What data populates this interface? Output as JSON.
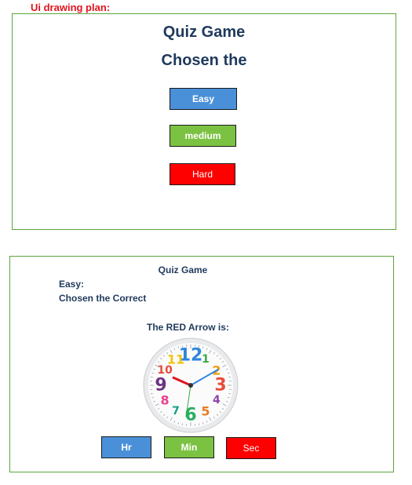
{
  "heading": "Ui drawing plan:",
  "screen1": {
    "title": "Quiz Game",
    "subtitle": "Chosen the",
    "buttons": {
      "easy": "Easy",
      "medium": "medium",
      "hard": "Hard"
    }
  },
  "screen2": {
    "title": "Quiz Game",
    "level": "Easy:",
    "instruction": "Chosen the Correct",
    "question": "The RED Arrow is:",
    "clock": {
      "numerals": [
        "12",
        "1",
        "2",
        "3",
        "4",
        "5",
        "6",
        "7",
        "8",
        "9",
        "10",
        "11"
      ],
      "red_hand_points_to_hour": 9.8,
      "blue_hand_points_to_hour": 2
    },
    "buttons": {
      "hr": "Hr",
      "min": "Min",
      "sec": "Sec"
    }
  },
  "colors": {
    "heading": "#e0141e",
    "frame_border": "#5aa53a",
    "title": "#1f3a5c",
    "easy": "#4a90d9",
    "medium": "#7cc242",
    "hard": "#ff0000"
  }
}
